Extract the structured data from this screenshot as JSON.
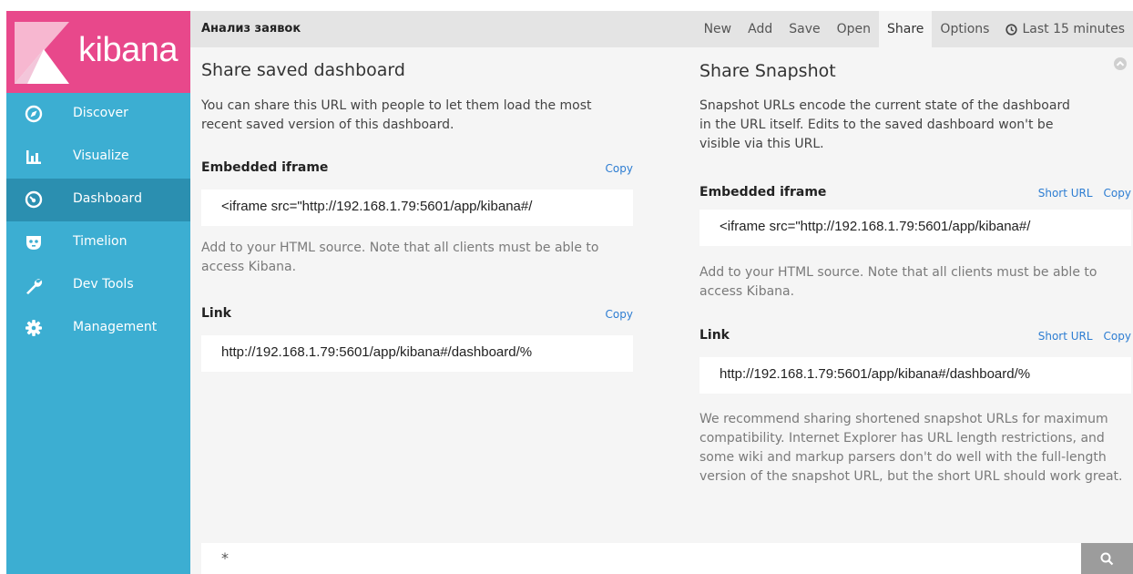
{
  "app": {
    "brand": "kibana",
    "title": "Анализ заявок"
  },
  "sidebar": {
    "items": [
      {
        "label": "Discover",
        "icon": "compass-icon"
      },
      {
        "label": "Visualize",
        "icon": "bar-chart-icon"
      },
      {
        "label": "Dashboard",
        "icon": "dashboard-gauge-icon",
        "active": true
      },
      {
        "label": "Timelion",
        "icon": "timelion-mask-icon"
      },
      {
        "label": "Dev Tools",
        "icon": "wrench-icon"
      },
      {
        "label": "Management",
        "icon": "gear-icon"
      }
    ]
  },
  "topbar": {
    "menu": [
      "New",
      "Add",
      "Save",
      "Open",
      "Share",
      "Options"
    ],
    "active": "Share",
    "time_label": "Last 15 minutes"
  },
  "share_saved": {
    "title": "Share saved dashboard",
    "description": "You can share this URL with people to let them load the most recent saved version of this dashboard.",
    "iframe_label": "Embedded iframe",
    "iframe_copy": "Copy",
    "iframe_value": "<iframe src=\"http://192.168.1.79:5601/app/kibana#/",
    "iframe_note": "Add to your HTML source. Note that all clients must be able to access Kibana.",
    "link_label": "Link",
    "link_copy": "Copy",
    "link_value": "http://192.168.1.79:5601/app/kibana#/dashboard/%"
  },
  "share_snapshot": {
    "title": "Share Snapshot",
    "description": "Snapshot URLs encode the current state of the dashboard in the URL itself. Edits to the saved dashboard won't be visible via this URL.",
    "iframe_label": "Embedded iframe",
    "iframe_short": "Short URL",
    "iframe_copy": "Copy",
    "iframe_value": "<iframe src=\"http://192.168.1.79:5601/app/kibana#/",
    "iframe_note": "Add to your HTML source. Note that all clients must be able to access Kibana.",
    "link_label": "Link",
    "link_short": "Short URL",
    "link_copy": "Copy",
    "link_value": "http://192.168.1.79:5601/app/kibana#/dashboard/%",
    "recommend_note": "We recommend sharing shortened snapshot URLs for maximum compatibility. Internet Explorer has URL length restrictions, and some wiki and markup parsers don't do well with the full-length version of the snapshot URL, but the short URL should work great."
  },
  "query": {
    "value": "*"
  },
  "colors": {
    "brand_pink": "#e8488b",
    "sidebar_blue": "#3caed2",
    "sidebar_active": "#2b8fb0",
    "link_blue": "#2d7dd2"
  }
}
